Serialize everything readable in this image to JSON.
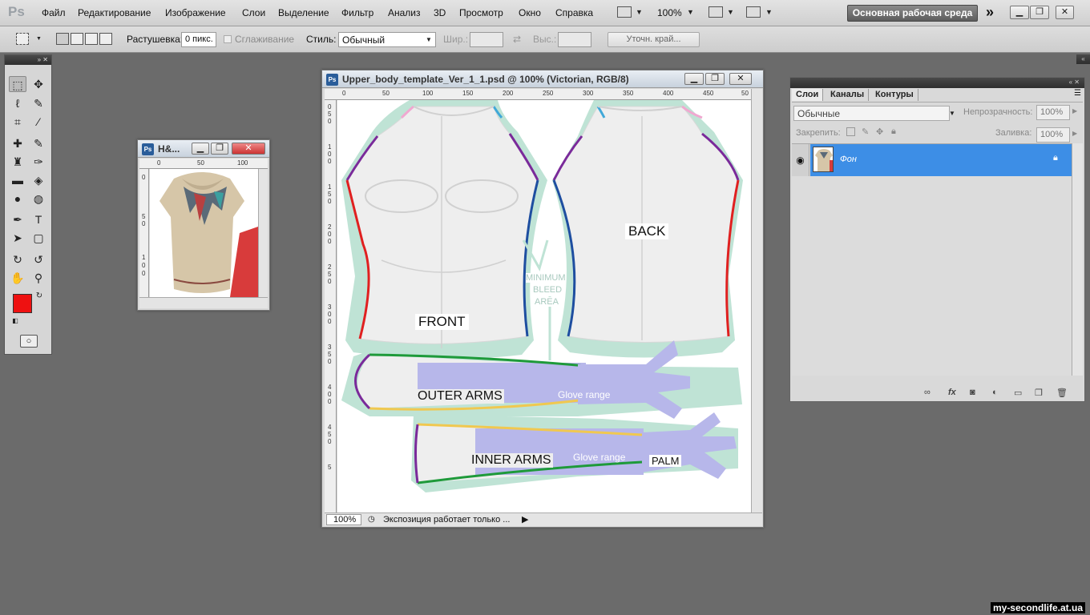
{
  "app": {
    "logo": "Ps"
  },
  "menu": [
    "Файл",
    "Редактирование",
    "Изображение",
    "Слои",
    "Выделение",
    "Фильтр",
    "Анализ",
    "3D",
    "Просмотр",
    "Окно",
    "Справка"
  ],
  "menubar_zoom": "100%",
  "workspace_label": "Основная рабочая среда",
  "workspace_more": "»",
  "window_controls": {
    "minimize": "▁",
    "restore": "❐",
    "close": "✕"
  },
  "options": {
    "feather_label": "Растушевка:",
    "feather_value": "0 пикс.",
    "antialias_label": "Сглаживание",
    "style_label": "Стиль:",
    "style_value": "Обычный",
    "width_label": "Шир.:",
    "height_label": "Выс.:",
    "refine_edge": "Уточн. край..."
  },
  "toolbox": {
    "collapse": "»",
    "close": "✕",
    "fg_color": "#ee1111",
    "bg_color": "#ffffff"
  },
  "small_doc": {
    "title": "H&...",
    "ruler_top": [
      "0",
      "50",
      "100"
    ],
    "ruler_left": [
      "0",
      "5",
      "0",
      "1",
      "0",
      "0"
    ]
  },
  "main_doc": {
    "title": "Upper_body_template_Ver_1_1.psd @ 100% (Victorian, RGB/8)",
    "ruler_top": [
      "0",
      "50",
      "100",
      "150",
      "200",
      "250",
      "300",
      "350",
      "400",
      "450",
      "50"
    ],
    "ruler_left": [
      "0",
      "5",
      "0",
      "1",
      "0",
      "0",
      "1",
      "5",
      "0",
      "2",
      "0",
      "0",
      "2",
      "5",
      "0",
      "3",
      "0",
      "0",
      "3",
      "5",
      "0",
      "4",
      "0",
      "0",
      "4",
      "5",
      "0",
      "5"
    ],
    "zoom": "100%",
    "status_text": "Экспозиция работает только ...",
    "labels": {
      "front": "FRONT",
      "back": "BACK",
      "outer_arms": "OUTER ARMS",
      "inner_arms": "INNER ARMS",
      "palm": "PALM",
      "glove_range_1": "Glove range",
      "glove_range_2": "Glove range",
      "min_bleed_1": "MINIMUM",
      "min_bleed_2": "BLEED",
      "min_bleed_3": "AREA"
    },
    "colors": {
      "bleed": "#bfe3d5",
      "body": "#eeeeee",
      "glove": "#b7b7ea",
      "red": "#e02020",
      "purple": "#7a2a9a",
      "blue": "#1e4ea0",
      "green": "#1e9a3a",
      "yellow": "#f0c850",
      "pink": "#f0a8d0",
      "cyan": "#40a8d8"
    }
  },
  "layers_panel": {
    "tabs": [
      "Слои",
      "Каналы",
      "Контуры"
    ],
    "blend_mode": "Обычные",
    "opacity_label": "Непрозрачность:",
    "opacity_value": "100%",
    "lock_label": "Закрепить:",
    "fill_label": "Заливка:",
    "fill_value": "100%",
    "layer_name": "Фон",
    "selected_color": "#3d8ee6"
  },
  "watermark": "my-secondlife.at.ua"
}
